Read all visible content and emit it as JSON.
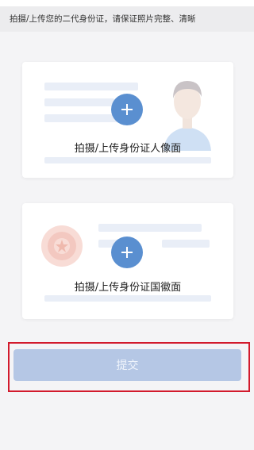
{
  "notice": {
    "text": "拍摄/上传您的二代身份证，请保证照片完整、清晰"
  },
  "cards": {
    "front": {
      "label": "拍摄/上传身份证人像面",
      "icon": "plus-icon",
      "image": "portrait-icon"
    },
    "back": {
      "label": "拍摄/上传身份证国徽面",
      "icon": "plus-icon",
      "image": "national-emblem-icon"
    }
  },
  "submit": {
    "label": "提交"
  },
  "colors": {
    "accent": "#5a8fd0",
    "submit_disabled": "#b5c7e5",
    "highlight_frame": "#d21a2c"
  }
}
